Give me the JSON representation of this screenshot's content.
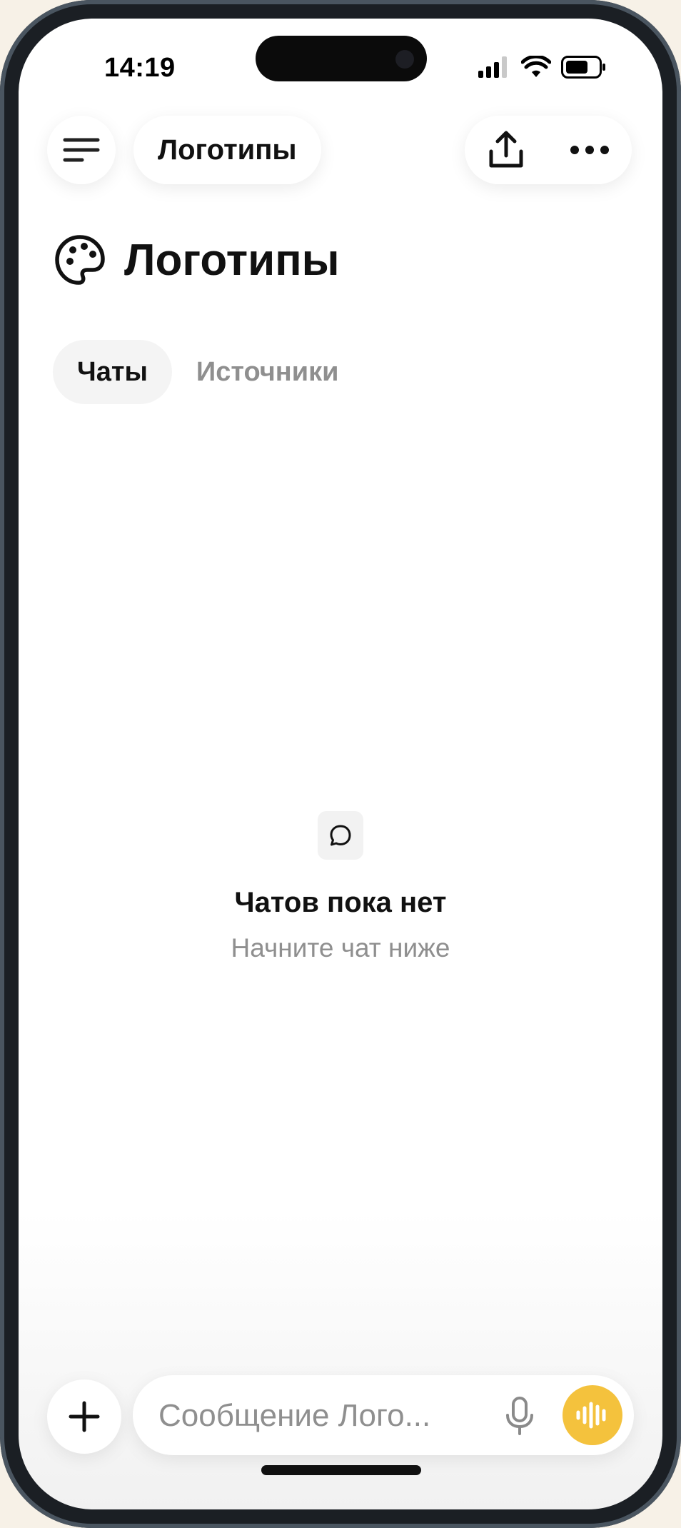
{
  "status_bar": {
    "time": "14:19"
  },
  "header": {
    "title": "Логотипы"
  },
  "page": {
    "title": "Логотипы"
  },
  "tabs": [
    {
      "label": "Чаты",
      "active": true
    },
    {
      "label": "Источники",
      "active": false
    }
  ],
  "empty_state": {
    "title": "Чатов пока нет",
    "subtitle": "Начните чат ниже"
  },
  "composer": {
    "placeholder": "Сообщение Лого..."
  },
  "colors": {
    "accent": "#f4c23d",
    "muted_text": "#8f8f8f"
  },
  "icons": {
    "menu": "menu-icon",
    "share": "share-icon",
    "more": "more-icon",
    "palette": "palette-icon",
    "chat_bubble": "chat-bubble-icon",
    "plus": "plus-icon",
    "mic": "mic-icon",
    "voice": "voice-wave-icon"
  }
}
